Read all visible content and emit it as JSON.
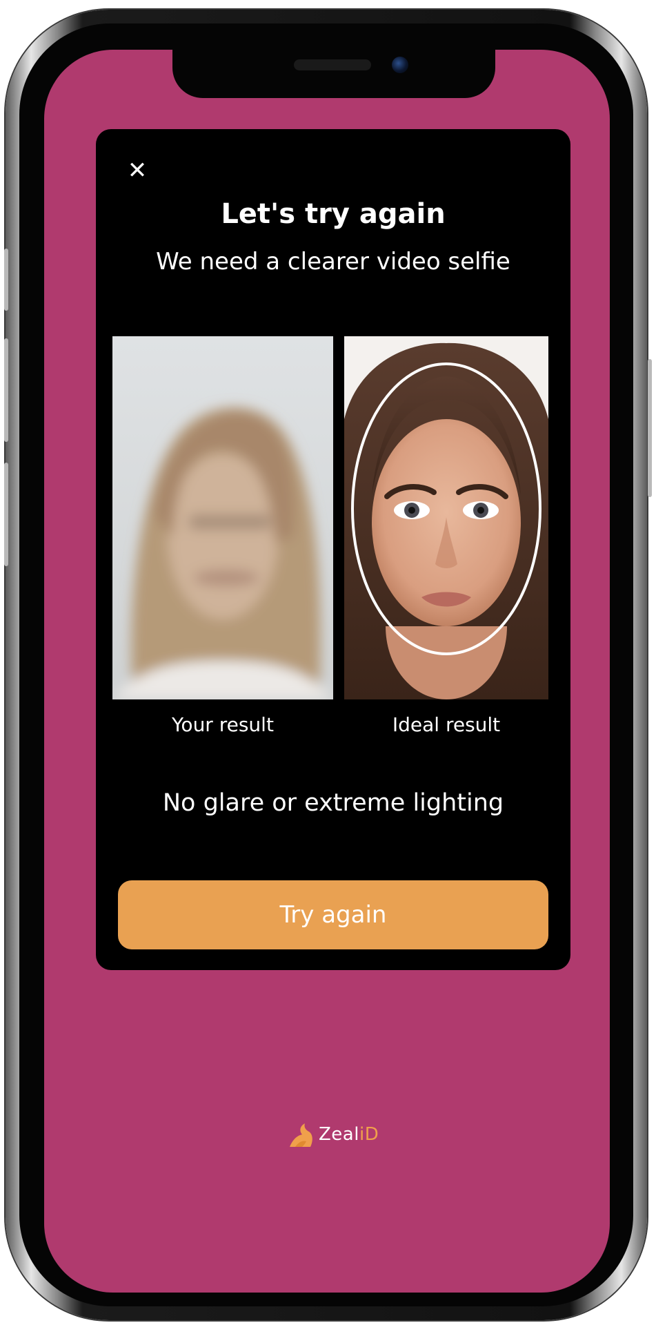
{
  "modal": {
    "close_icon": "close-icon",
    "title": "Let's try again",
    "subtitle": "We need a clearer video selfie",
    "your_result_label": "Your result",
    "ideal_result_label": "Ideal result",
    "tip": "No glare or extreme lighting",
    "try_again_label": "Try again"
  },
  "brand": {
    "name_prefix": "Zeal",
    "name_suffix": "iD",
    "logo_icon": "zealid-logo-icon"
  },
  "colors": {
    "background": "#b03a6e",
    "card": "#000000",
    "button": "#e9a152",
    "brand_accent": "#f0a04b"
  }
}
